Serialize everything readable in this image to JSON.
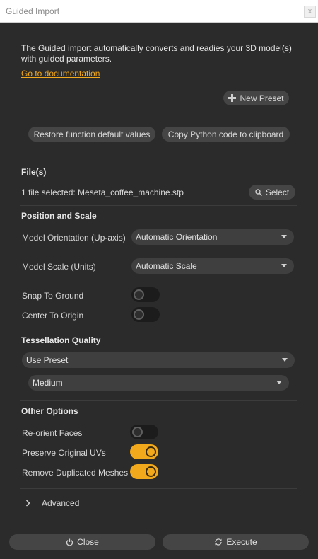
{
  "window": {
    "title": "Guided Import",
    "close_glyph": "x"
  },
  "intro": {
    "text": "The Guided import automatically converts and readies your 3D model(s) with guided parameters.",
    "doc_link": "Go to documentation"
  },
  "toolbar": {
    "new_preset": "New Preset",
    "restore_defaults": "Restore function default values",
    "copy_python": "Copy Python code to clipboard"
  },
  "files": {
    "title": "File(s)",
    "selected_text": "1 file selected: Meseta_coffee_machine.stp",
    "select_button": "Select"
  },
  "position_scale": {
    "title": "Position and Scale",
    "orientation_label": "Model Orientation (Up-axis)",
    "orientation_value": "Automatic Orientation",
    "scale_label": "Model Scale (Units)",
    "scale_value": "Automatic Scale",
    "snap_label": "Snap To Ground",
    "snap_on": false,
    "center_label": "Center To Origin",
    "center_on": false
  },
  "tessellation": {
    "title": "Tessellation Quality",
    "mode_value": "Use Preset",
    "preset_value": "Medium"
  },
  "other_options": {
    "title": "Other Options",
    "reorient_label": "Re-orient Faces",
    "reorient_on": false,
    "preserve_uvs_label": "Preserve Original UVs",
    "preserve_uvs_on": true,
    "remove_dup_label": "Remove Duplicated Meshes",
    "remove_dup_on": true
  },
  "advanced": {
    "label": "Advanced"
  },
  "footer": {
    "close": "Close",
    "execute": "Execute"
  },
  "colors": {
    "accent": "#f2a91b",
    "background": "#2b2b2b",
    "control": "#454545"
  }
}
